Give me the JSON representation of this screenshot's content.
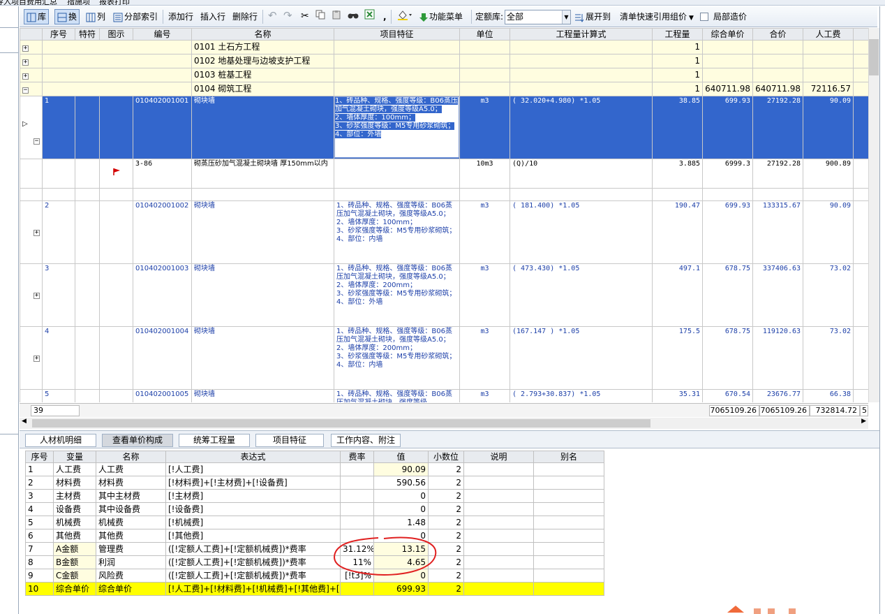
{
  "app": {
    "menu_fragments": [
      "导入项目",
      "费用汇总",
      "措施项",
      "报表打印"
    ]
  },
  "toolbar": {
    "lib": "库",
    "swap": "换",
    "col": "列",
    "index": "分部索引",
    "add_row": "添加行",
    "insert_row": "插入行",
    "delete_row": "删除行",
    "func_menu": "功能菜单",
    "quota_label": "定额库:",
    "quota_value": "全部",
    "expand": "展开到",
    "quick_ref": "清单快速引用组价",
    "local_cost": "局部造价"
  },
  "grid": {
    "headers": [
      "序号",
      "特符",
      "图示",
      "编号",
      "名称",
      "项目特征",
      "单位",
      "工程量计算式",
      "工程量",
      "综合单价",
      "合价",
      "人工费"
    ],
    "sections": [
      {
        "code": "0101",
        "name": "土石方工程",
        "qty": "1",
        "unit_price": "",
        "total": "",
        "labor": ""
      },
      {
        "code": "0102",
        "name": "地基处理与边坡支护工程",
        "qty": "1",
        "unit_price": "",
        "total": "",
        "labor": ""
      },
      {
        "code": "0103",
        "name": "桩基工程",
        "qty": "1",
        "unit_price": "",
        "total": "",
        "labor": ""
      },
      {
        "code": "0104",
        "name": "砌筑工程",
        "qty": "1",
        "unit_price": "640711.98",
        "total": "640711.98",
        "labor": "72116.57"
      }
    ],
    "items": [
      {
        "seq": "1",
        "code": "010402001001",
        "name": "砌块墙",
        "feature": "1、砖品种、规格、强度等级：B06蒸压加气混凝土砌块，强度等级A5.0；\n2、墙体厚度：100mm；\n3、砂浆强度等级：M5专用砂浆砌筑；\n4、部位：外墙",
        "unit": "m3",
        "formula": "( 32.020+4.980) *1.05",
        "qty": "38.85",
        "unit_price": "699.93",
        "total": "27192.28",
        "labor": "90.09"
      },
      {
        "seq": "2",
        "code": "010402001002",
        "name": "砌块墙",
        "feature": "1、砖品种、规格、强度等级：B06蒸压加气混凝土砌块，强度等级A5.0；\n2、墙体厚度：100mm；\n3、砂浆强度等级：M5专用砂浆砌筑；\n4、部位：内墙",
        "unit": "m3",
        "formula": "( 181.400) *1.05",
        "qty": "190.47",
        "unit_price": "699.93",
        "total": "133315.67",
        "labor": "90.09"
      },
      {
        "seq": "3",
        "code": "010402001003",
        "name": "砌块墙",
        "feature": "1、砖品种、规格、强度等级：B06蒸压加气混凝土砌块，强度等级A5.0；\n2、墙体厚度：200mm；\n3、砂浆强度等级：M5专用砂浆砌筑；\n4、部位：外墙",
        "unit": "m3",
        "formula": "( 473.430) *1.05",
        "qty": "497.1",
        "unit_price": "678.75",
        "total": "337406.63",
        "labor": "73.02"
      },
      {
        "seq": "4",
        "code": "010402001004",
        "name": "砌块墙",
        "feature": "1、砖品种、规格、强度等级：B06蒸压加气混凝土砌块，强度等级A5.0；\n2、墙体厚度：200mm；\n3、砂浆强度等级：M5专用砂浆砌筑；\n4、部位：内墙",
        "unit": "m3",
        "formula": "(167.147 ) *1.05",
        "qty": "175.5",
        "unit_price": "678.75",
        "total": "119120.63",
        "labor": "73.02"
      },
      {
        "seq": "5",
        "code": "010402001005",
        "name": "砌块墙",
        "feature": "1、砖品种、规格、强度等级：B06蒸压加气混凝土砌块，强度等级",
        "unit": "m3",
        "formula": "( 2.793+30.837) *1.05",
        "qty": "35.31",
        "unit_price": "670.54",
        "total": "23676.77",
        "labor": "66.38"
      }
    ],
    "sub": {
      "code": "3-86",
      "name": "砌蒸压砂加气混凝土砌块墙 厚150mm以内",
      "unit": "10m3",
      "formula": "(Q)/10",
      "qty": "3.885",
      "unit_price": "6999.3",
      "total": "27192.28",
      "labor": "900.89"
    },
    "footer": {
      "count": "39",
      "a": "7065109.26",
      "b": "7065109.26",
      "c": "732814.72",
      "d": "5"
    }
  },
  "lower_tabs": [
    "人材机明细",
    "查看单价构成",
    "统筹工程量",
    "项目特征",
    "工作内容、附注"
  ],
  "breakdown": {
    "headers": [
      "序号",
      "变量",
      "名称",
      "表达式",
      "费率",
      "值",
      "小数位",
      "说明",
      "别名"
    ],
    "rows": [
      {
        "seq": "1",
        "var": "人工费",
        "name": "人工费",
        "expr": "[!人工费]",
        "rate": "",
        "value": "90.09",
        "dec": "2"
      },
      {
        "seq": "2",
        "var": "材料费",
        "name": "材料费",
        "expr": "[!材料费]+[!主材费]+[!设备费]",
        "rate": "",
        "value": "590.56",
        "dec": "2"
      },
      {
        "seq": "3",
        "var": "主材费",
        "name": "其中主材费",
        "expr": "[!主材费]",
        "rate": "",
        "value": "0",
        "dec": "2"
      },
      {
        "seq": "4",
        "var": "设备费",
        "name": "其中设备费",
        "expr": "[!设备费]",
        "rate": "",
        "value": "0",
        "dec": "2"
      },
      {
        "seq": "5",
        "var": "机械费",
        "name": "机械费",
        "expr": "[!机械费]",
        "rate": "",
        "value": "1.48",
        "dec": "2"
      },
      {
        "seq": "6",
        "var": "其他费",
        "name": "其他费",
        "expr": "[!其他费]",
        "rate": "",
        "value": "0",
        "dec": "2"
      },
      {
        "seq": "7",
        "var": "A金额",
        "name": "管理费",
        "expr": "([!定额人工费]+[!定额机械费])*费率",
        "rate": "31.12%",
        "value": "13.15",
        "dec": "2"
      },
      {
        "seq": "8",
        "var": "B金额",
        "name": "利润",
        "expr": "([!定额人工费]+[!定额机械费])*费率",
        "rate": "11%",
        "value": "4.65",
        "dec": "2"
      },
      {
        "seq": "9",
        "var": "C金额",
        "name": "风险费",
        "expr": "([!定额人工费]+[!定额机械费])*费率",
        "rate": "[!t3]%",
        "value": "0",
        "dec": "2"
      },
      {
        "seq": "10",
        "var": "综合单价",
        "name": "综合单价",
        "expr": "[!人工费]+[!材料费]+[!机械费]+[!其他费]+[",
        "rate": "",
        "value": "699.93",
        "dec": "2"
      }
    ]
  },
  "colors": {
    "selection": "#3366cc",
    "section_bg": "#fffde0",
    "total_bg": "#ffff00",
    "annotation": "#e02020"
  }
}
